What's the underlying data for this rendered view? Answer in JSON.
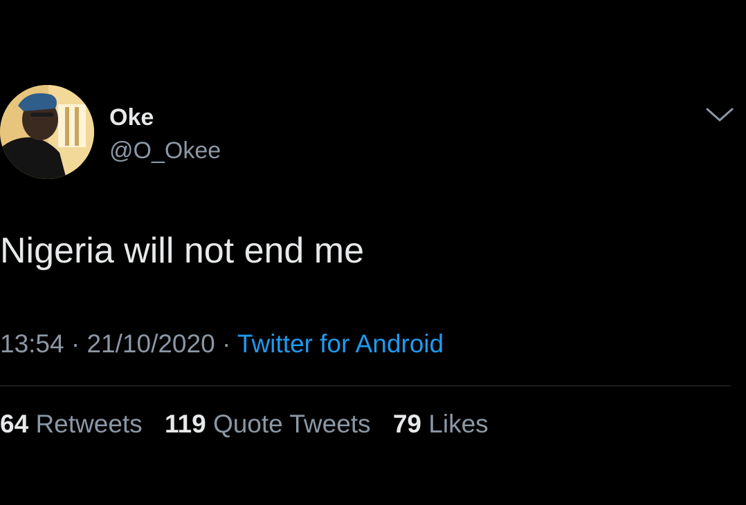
{
  "tweet": {
    "author": {
      "display_name": "Oke",
      "handle": "@O_Okee",
      "avatar": "profile-photo"
    },
    "menu_icon": "chevron-down-icon",
    "text": "Nigeria will not end me",
    "time": "13:54",
    "date": "21/10/2020",
    "separator": "·",
    "source": "Twitter for Android",
    "stats": {
      "retweets_count": "64",
      "retweets_label": "Retweets",
      "quotes_count": "119",
      "quotes_label": "Quote Tweets",
      "likes_count": "79",
      "likes_label": "Likes"
    }
  },
  "colors": {
    "background": "#000000",
    "primary_text": "#e7e9ea",
    "secondary_text": "#8b98a5",
    "link": "#1d9bf0",
    "divider": "#2f3336"
  }
}
